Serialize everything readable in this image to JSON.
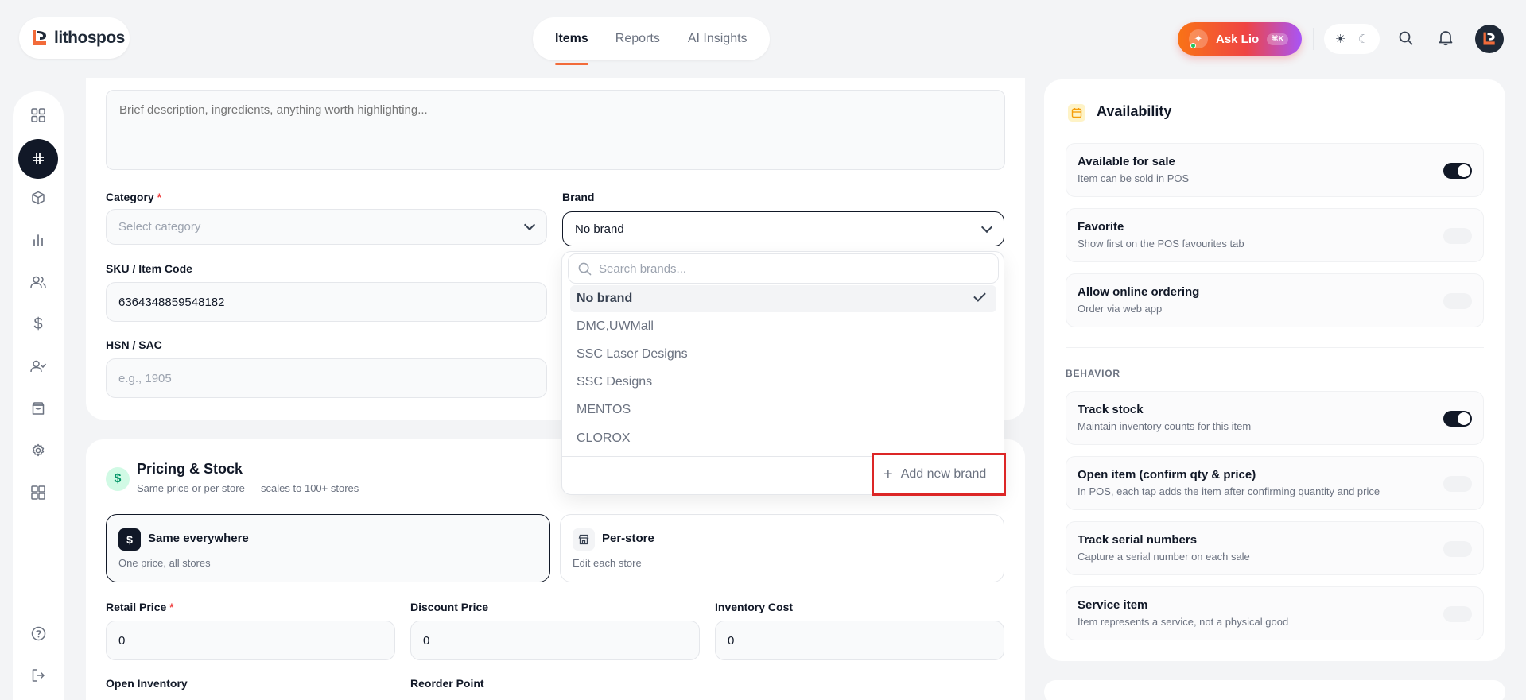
{
  "app": {
    "logo_text": "lithospos"
  },
  "nav": {
    "tabs": [
      {
        "label": "Items"
      },
      {
        "label": "Reports"
      },
      {
        "label": "AI Insights"
      }
    ]
  },
  "top": {
    "ask_label": "Ask Lio",
    "ask_shortcut": "⌘K"
  },
  "form": {
    "description_placeholder": "Brief description, ingredients, anything worth highlighting...",
    "category_label": "Category",
    "category_placeholder": "Select category",
    "brand_label": "Brand",
    "brand_value": "No brand",
    "sku_label": "SKU / Item Code",
    "sku_value": "6364348859548182",
    "hsn_label": "HSN / SAC",
    "hsn_placeholder": "e.g., 1905",
    "required_mark": "*"
  },
  "brand_dropdown": {
    "search_placeholder": "Search brands...",
    "options": [
      "No brand",
      "DMC,UWMall",
      "SSC Laser Designs",
      "SSC Designs",
      "MENTOS",
      "CLOROX"
    ],
    "add_label": "Add new brand"
  },
  "pricing": {
    "title": "Pricing & Stock",
    "subtitle": "Same price or per store — scales to 100+ stores",
    "modes": [
      {
        "title": "Same everywhere",
        "sub": "One price, all stores"
      },
      {
        "title": "Per-store",
        "sub": "Edit each store"
      }
    ],
    "retail_label": "Retail Price",
    "retail_value": "0",
    "discount_label": "Discount Price",
    "discount_value": "0",
    "cost_label": "Inventory Cost",
    "cost_value": "0",
    "open_inv_label": "Open Inventory",
    "reorder_label": "Reorder Point"
  },
  "availability": {
    "title": "Availability",
    "rows": [
      {
        "title": "Available for sale",
        "sub": "Item can be sold in POS",
        "on": true
      },
      {
        "title": "Favorite",
        "sub": "Show first on the POS favourites tab",
        "on": false
      },
      {
        "title": "Allow online ordering",
        "sub": "Order via web app",
        "on": false
      }
    ],
    "behavior_label": "BEHAVIOR",
    "behavior_rows": [
      {
        "title": "Track stock",
        "sub": "Maintain inventory counts for this item",
        "on": true
      },
      {
        "title": "Open item (confirm qty & price)",
        "sub": "In POS, each tap adds the item after confirming quantity and price",
        "on": false
      },
      {
        "title": "Track serial numbers",
        "sub": "Capture a serial number on each sale",
        "on": false
      },
      {
        "title": "Service item",
        "sub": "Item represents a service, not a physical good",
        "on": false
      }
    ]
  }
}
